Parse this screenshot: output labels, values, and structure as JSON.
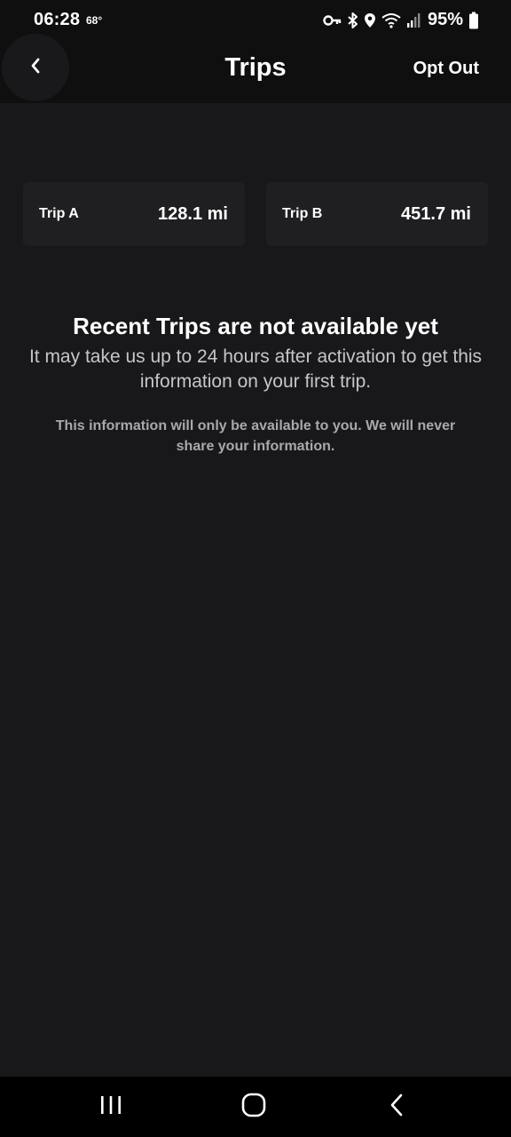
{
  "status_bar": {
    "time": "06:28",
    "temperature": "68°",
    "battery": "95%",
    "icons": [
      "vpn-key-icon",
      "bluetooth-icon",
      "location-icon",
      "wifi-icon",
      "signal-icon",
      "battery-icon"
    ]
  },
  "header": {
    "title": "Trips",
    "opt_out_label": "Opt Out",
    "back_icon": "chevron-left-icon"
  },
  "trips": [
    {
      "name": "Trip A",
      "value": "128.1 mi"
    },
    {
      "name": "Trip B",
      "value": "451.7 mi"
    }
  ],
  "empty_state": {
    "title": "Recent Trips are not available yet",
    "body": "It may take us up to 24 hours after activation to get this information on your first trip.",
    "note": "This information will only be available to you. We will never share your information."
  },
  "nav_bar": {
    "icons": [
      "recents-icon",
      "home-icon",
      "back-icon"
    ]
  },
  "colors": {
    "background": "#18181a",
    "header": "#0f0f10",
    "card": "#1f1f22",
    "text_primary": "#ffffff",
    "text_secondary": "#c6c6c8",
    "text_muted": "#a9a9ac"
  }
}
